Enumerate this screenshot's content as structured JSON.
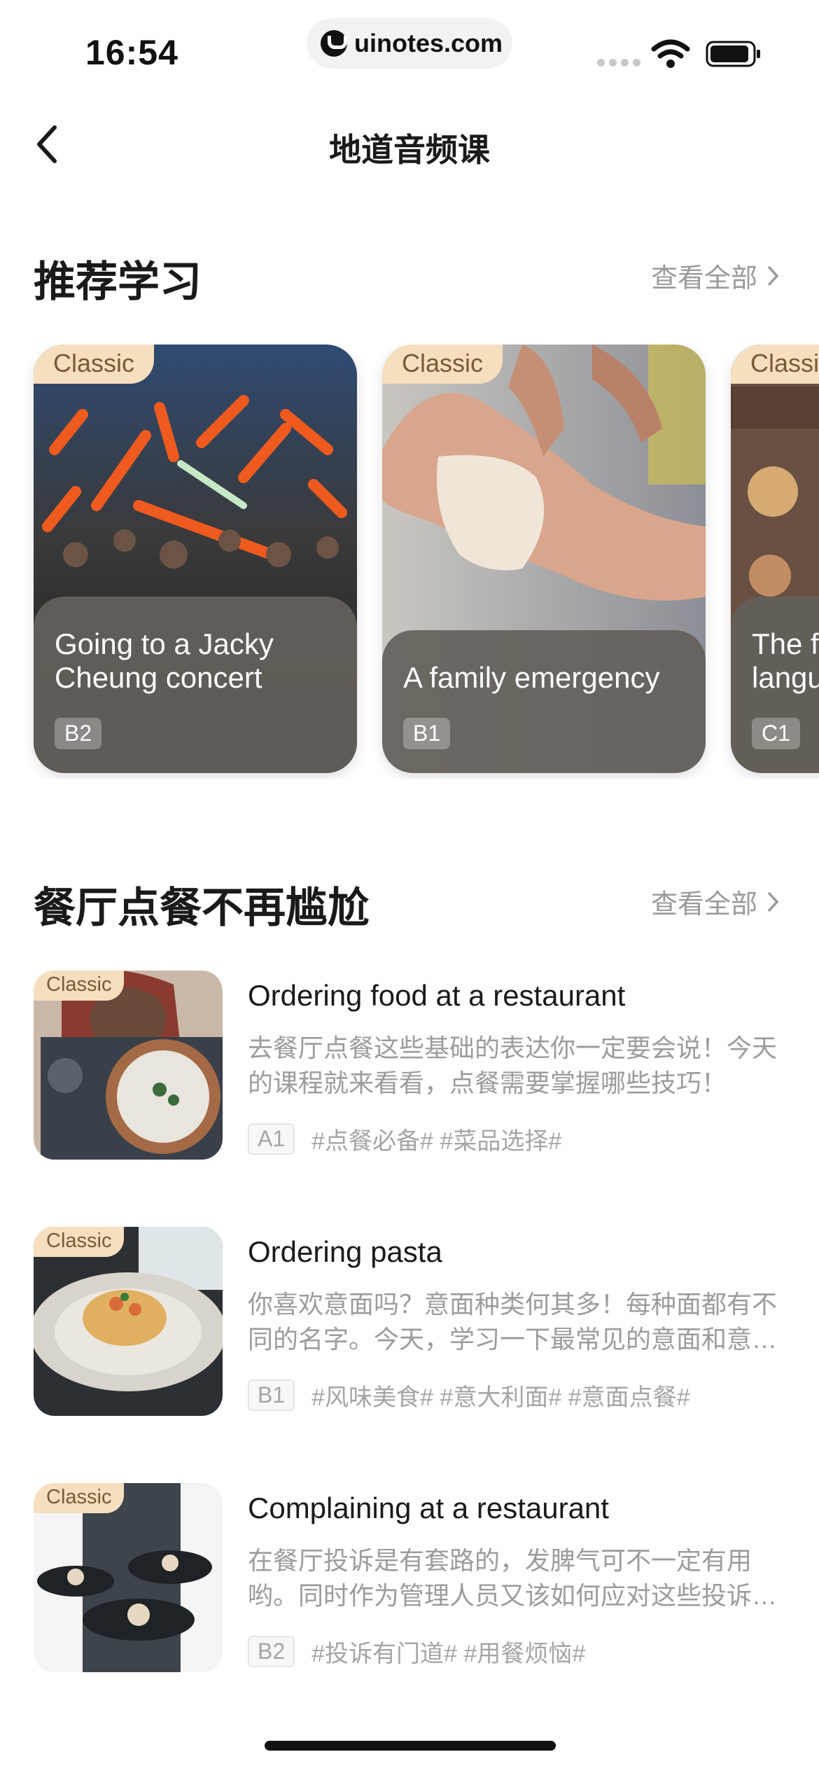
{
  "status_bar": {
    "time": "16:54",
    "url": "uinotes.com"
  },
  "nav": {
    "title": "地道音频课"
  },
  "recommended": {
    "title": "推荐学习",
    "see_all": "查看全部",
    "cards": [
      {
        "tag": "Classic",
        "title_lines": [
          "Going to a Jacky",
          "Cheung concert"
        ],
        "level": "B2"
      },
      {
        "tag": "Classic",
        "title_lines": [
          "A family emergency"
        ],
        "level": "B1"
      },
      {
        "tag": "Classic",
        "title_lines": [
          "The f",
          "langu"
        ],
        "level": "C1"
      }
    ]
  },
  "restaurant": {
    "title": "餐厅点餐不再尴尬",
    "see_all": "查看全部",
    "items": [
      {
        "tag": "Classic",
        "title": "Ordering food at a restaurant",
        "desc_lines": [
          "去餐厅点餐这些基础的表达你一定要会说！今天",
          "的课程就来看看，点餐需要掌握哪些技巧！"
        ],
        "level": "A1",
        "tags": "#点餐必备# #菜品选择#"
      },
      {
        "tag": "Classic",
        "title": "Ordering pasta",
        "desc_lines": [
          "你喜欢意面吗？意面种类何其多！每种面都有不",
          "同的名字。今天，学习一下最常见的意面和意…"
        ],
        "level": "B1",
        "tags": "#风味美食# #意大利面# #意面点餐#"
      },
      {
        "tag": "Classic",
        "title": "Complaining at a restaurant",
        "desc_lines": [
          "在餐厅投诉是有套路的，发脾气可不一定有用",
          "哟。同时作为管理人员又该如何应对这些投诉…"
        ],
        "level": "B2",
        "tags": "#投诉有门道# #用餐烦恼#"
      }
    ]
  }
}
